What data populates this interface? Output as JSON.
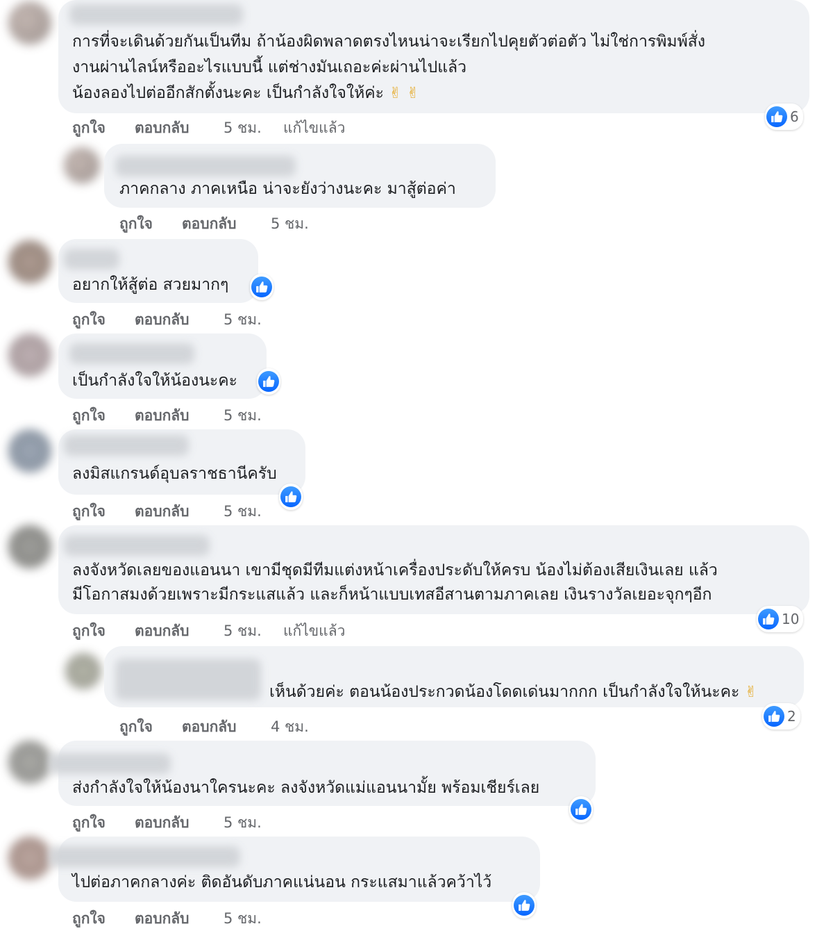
{
  "colors": {
    "bubble": "#f0f2f5",
    "meta_text": "#65676b",
    "like_blue": "#0866ff"
  },
  "actions": {
    "like": "ถูกใจ",
    "reply": "ตอบกลับ",
    "edited": "แก้ไขแล้ว"
  },
  "comments": [
    {
      "lines": [
        "การที่จะเดินด้วยกันเป็นทีม ถ้าน้องผิดพลาดตรงไหนน่าจะเรียกไปคุยตัวต่อตัว ไม่ใช่การพิมพ์สั่ง",
        "งานผ่านไลน์หรืออะไรแบบนี้ แต่ช่างมันเถอะค่ะผ่านไปแล้ว",
        "น้องลองไปต่ออีกสักตั้งนะคะ เป็นกำลังใจให้ค่ะ"
      ],
      "emoji": "✌ ✌",
      "time": "5 ชม.",
      "edited": true,
      "reaction_count": "6",
      "reaction_icon": "like-icon"
    },
    {
      "lines": [
        "ภาคกลาง ภาคเหนือ น่าจะยังว่างนะคะ มาสู้ต่อค่า"
      ],
      "time": "5 ชม.",
      "edited": false,
      "reaction_count": "",
      "reaction_icon": ""
    },
    {
      "lines": [
        "อยากให้สู้ต่อ สวยมากๆ"
      ],
      "time": "5 ชม.",
      "edited": false,
      "reaction_count": "",
      "reaction_icon": "like-icon"
    },
    {
      "lines": [
        "เป็นกำลังใจให้น้องนะคะ"
      ],
      "time": "5 ชม.",
      "edited": false,
      "reaction_count": "",
      "reaction_icon": "like-icon"
    },
    {
      "lines": [
        "ลงมิสแกรนด์อุบลราชธานีครับ"
      ],
      "time": "5 ชม.",
      "edited": false,
      "reaction_count": "",
      "reaction_icon": "like-icon"
    },
    {
      "lines": [
        "ลงจังหวัดเลยของแอนนา เขามีชุดมีทีมแต่งหน้าเครื่องประดับให้ครบ น้องไม่ต้องเสียเงินเลย แล้ว",
        "มีโอกาสมงด้วยเพราะมีกระแสแล้ว และก็หน้าแบบเทสอีสานตามภาคเลย เงินรางวัลเยอะจุกๆอีก"
      ],
      "time": "5 ชม.",
      "edited": true,
      "reaction_count": "10",
      "reaction_icon": "like-icon"
    },
    {
      "lines": [
        "เห็นด้วยค่ะ ตอนน้องประกวดน้องโดดเด่นมากกก เป็นกำลังใจให้นะคะ"
      ],
      "emoji": "✌",
      "time": "4 ชม.",
      "edited": false,
      "reaction_count": "2",
      "reaction_icon": "like-icon"
    },
    {
      "lines": [
        "ส่งกำลังใจให้น้องนาใครนะคะ ลงจังหวัดแม่แอนนามั้ย พร้อมเชียร์เลย"
      ],
      "time": "5 ชม.",
      "edited": false,
      "reaction_count": "",
      "reaction_icon": "like-icon"
    },
    {
      "lines": [
        "ไปต่อภาคกลางค่ะ ติดอันดับภาคแน่นอน กระแสมาแล้วคว้าไว้"
      ],
      "time": "5 ชม.",
      "edited": false,
      "reaction_count": "",
      "reaction_icon": "like-icon"
    }
  ]
}
